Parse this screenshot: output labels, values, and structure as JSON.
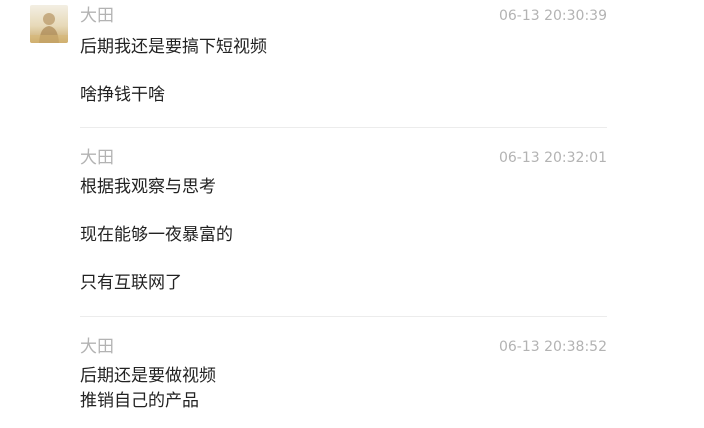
{
  "messages": [
    {
      "sender": "大田",
      "time": "06-13 20:30:39",
      "lines": [
        "后期我还是要搞下短视频",
        "啥挣钱干啥"
      ]
    },
    {
      "sender": "大田",
      "time": "06-13 20:32:01",
      "lines": [
        "根据我观察与思考",
        "现在能够一夜暴富的",
        "只有互联网了"
      ]
    },
    {
      "sender": "大田",
      "time": "06-13 20:38:52",
      "lines": [
        "后期还是要做视频",
        "推销自己的产品"
      ]
    }
  ],
  "avatar": {
    "icon": "user-avatar-icon"
  }
}
